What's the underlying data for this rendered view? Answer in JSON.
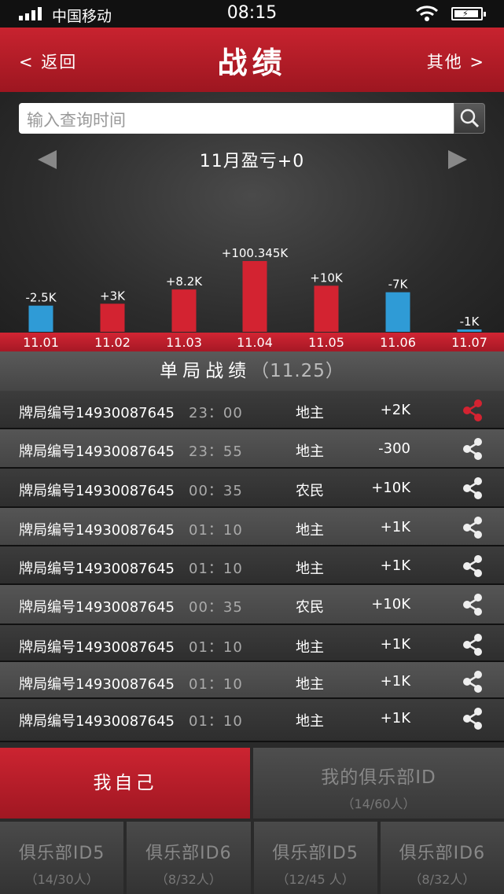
{
  "status": {
    "carrier": "中国移动",
    "time": "08:15"
  },
  "header": {
    "back_label": "< 返回",
    "title": "战绩",
    "other_label": "其他 >"
  },
  "search": {
    "placeholder": "输入查询时间"
  },
  "month": {
    "title": "11月盈亏+0"
  },
  "chart_data": {
    "type": "bar",
    "categories": [
      "11.01",
      "11.02",
      "11.03",
      "11.04",
      "11.05",
      "11.06",
      "11.07"
    ],
    "values": [
      -2.5,
      3,
      8.2,
      100.345,
      10,
      -7,
      -1
    ],
    "labels": [
      "-2.5K",
      "+3K",
      "+8.2K",
      "+100.345K",
      "+10K",
      "-7K",
      "-1K"
    ],
    "colors": {
      "positive": "#d32331",
      "negative": "#2f9bd6"
    }
  },
  "section": {
    "title": "单局战绩",
    "date": "（11.25）"
  },
  "games": [
    {
      "id": "牌局编号14930087645",
      "time": "23：00",
      "role": "地主",
      "score": "+2K",
      "highlight": true
    },
    {
      "id": "牌局编号14930087645",
      "time": "23：55",
      "role": "地主",
      "score": "-300",
      "highlight": false
    },
    {
      "id": "牌局编号14930087645",
      "time": "00：35",
      "role": "农民",
      "score": "+10K",
      "highlight": false
    },
    {
      "id": "牌局编号14930087645",
      "time": "01：10",
      "role": "地主",
      "score": "+1K",
      "highlight": false
    },
    {
      "id": "牌局编号14930087645",
      "time": "01：10",
      "role": "地主",
      "score": "+1K",
      "highlight": false
    },
    {
      "id": "牌局编号14930087645",
      "time": "00：35",
      "role": "农民",
      "score": "+10K",
      "highlight": false
    },
    {
      "id": "牌局编号14930087645",
      "time": "01：10",
      "role": "地主",
      "score": "+1K",
      "highlight": false
    },
    {
      "id": "牌局编号14930087645",
      "time": "01：10",
      "role": "地主",
      "score": "+1K",
      "highlight": false
    },
    {
      "id": "牌局编号14930087645",
      "time": "01：10",
      "role": "地主",
      "score": "+1K",
      "highlight": false
    }
  ],
  "tabs": {
    "self_label": "我自己",
    "club_label": "我的俱乐部ID",
    "club_count": "（14/60人）"
  },
  "clubs": [
    {
      "name": "俱乐部ID5",
      "count": "（14/30人）"
    },
    {
      "name": "俱乐部ID6",
      "count": "（8/32人）"
    },
    {
      "name": "俱乐部ID5",
      "count": "（12/45 人）"
    },
    {
      "name": "俱乐部ID6",
      "count": "（8/32人）"
    }
  ],
  "icons": {
    "share": "share-icon",
    "search": "search-icon"
  }
}
